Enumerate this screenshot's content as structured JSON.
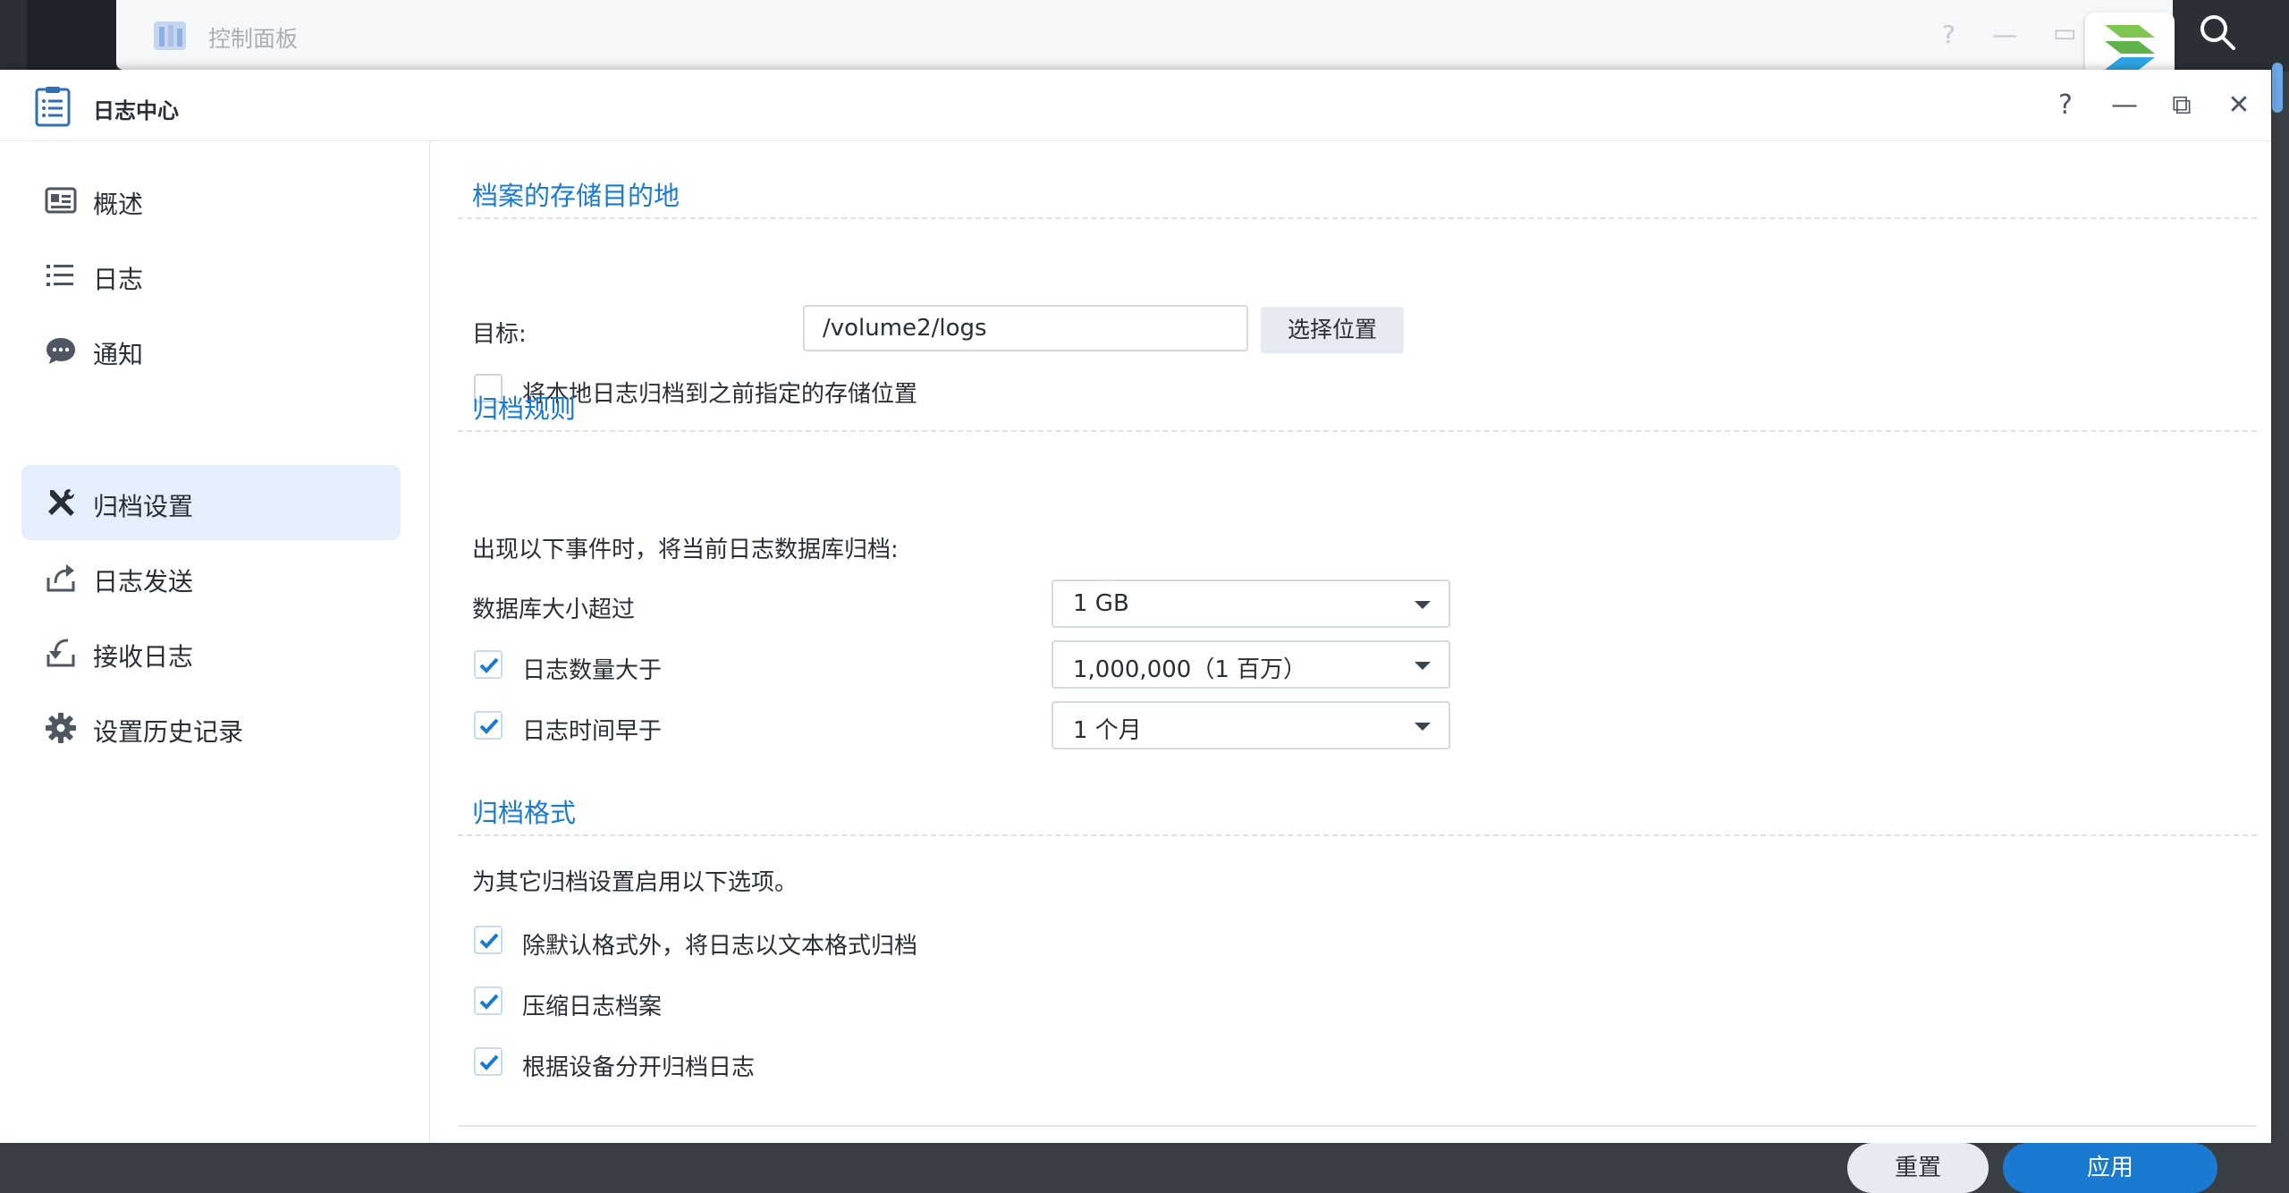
{
  "background_window": {
    "title": "控制面板",
    "controls": [
      "?",
      "—",
      "▭"
    ]
  },
  "window": {
    "title": "日志中心",
    "controls": {
      "help": "?",
      "minimize": "—",
      "restore": "⧉",
      "close": "✕"
    }
  },
  "sidebar": {
    "items": [
      {
        "label": "概述",
        "icon": "overview-icon",
        "active": false
      },
      {
        "label": "日志",
        "icon": "list-icon",
        "active": false
      },
      {
        "label": "通知",
        "icon": "chat-bubble-icon",
        "active": false
      },
      {
        "label": "归档设置",
        "icon": "tools-icon",
        "active": true
      },
      {
        "label": "日志发送",
        "icon": "upload-icon",
        "active": false
      },
      {
        "label": "接收日志",
        "icon": "download-icon",
        "active": false
      },
      {
        "label": "设置历史记录",
        "icon": "gear-icon",
        "active": false
      }
    ]
  },
  "storage": {
    "section_title": "档案的存储目的地",
    "target_label": "目标:",
    "target_value": "/volume2/logs",
    "choose_button": "选择位置",
    "archive_local_checkbox": {
      "label": "将本地日志归档到之前指定的存储位置",
      "checked": false
    }
  },
  "rules": {
    "section_title": "归档规则",
    "description": "出现以下事件时，将当前日志数据库归档:",
    "db_size": {
      "label": "数据库大小超过",
      "value": "1 GB"
    },
    "log_count": {
      "label": "日志数量大于",
      "checked": true,
      "value": "1,000,000（1 百万）"
    },
    "log_time": {
      "label": "日志时间早于",
      "checked": true,
      "value": "1 个月"
    }
  },
  "format": {
    "section_title": "归档格式",
    "description": "为其它归档设置启用以下选项。",
    "options": [
      {
        "label": "除默认格式外，将日志以文本格式归档",
        "checked": true
      },
      {
        "label": "压缩日志档案",
        "checked": true
      },
      {
        "label": "根据设备分开归档日志",
        "checked": true
      }
    ]
  },
  "footer": {
    "reset_label": "重置",
    "apply_label": "应用"
  },
  "colors": {
    "accent": "#1a7ad1",
    "active_nav_bg": "#e4effb",
    "text": "#2a2f36"
  }
}
